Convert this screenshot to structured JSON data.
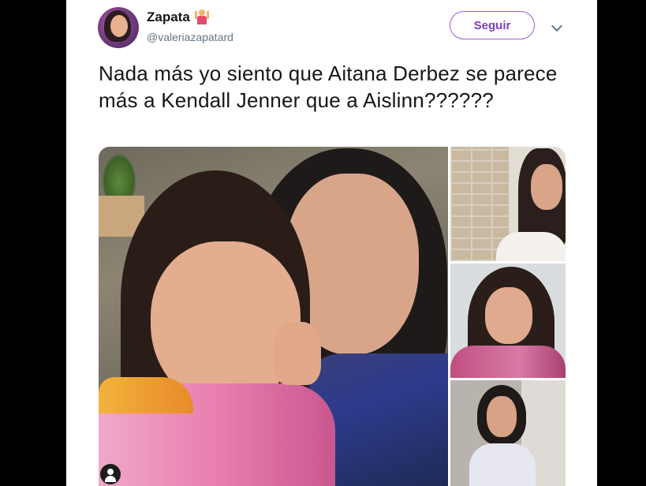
{
  "tweet": {
    "author_name": "Zapata",
    "author_handle": "@valeriazapatard",
    "follow_label": "Seguir",
    "text": "Nada más yo siento que Aitana Derbez se parece más a Kendall Jenner que a Aislinn??????"
  },
  "icons": {
    "name_badge": "dancer-emoji-icon",
    "menu": "chevron-down-icon",
    "tag": "user-tag-icon"
  },
  "colors": {
    "accent": "#7b3fbf",
    "text": "#14171a",
    "muted": "#657786",
    "background": "#000000"
  },
  "media": {
    "count": 4
  }
}
